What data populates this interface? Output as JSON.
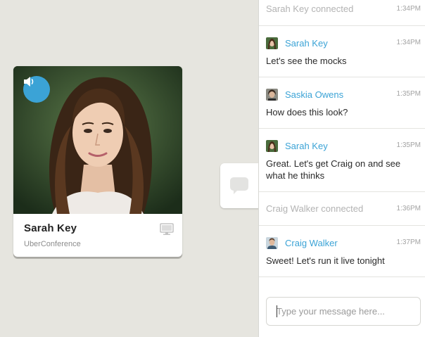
{
  "participant": {
    "name": "Sarah Key",
    "subtitle": "UberConference"
  },
  "icons": {
    "speaker": "speaker-icon",
    "screen": "screen-share-icon",
    "chat": "chat-bubble-icon"
  },
  "colors": {
    "accent": "#3ba3d6",
    "background": "#e6e5df"
  },
  "chat": {
    "events": [
      {
        "type": "system",
        "text": "Sarah Key connected",
        "time": "1:34PM"
      },
      {
        "type": "message",
        "sender": "Sarah Key",
        "time": "1:34PM",
        "text": "Let's see the mocks"
      },
      {
        "type": "message",
        "sender": "Saskia Owens",
        "time": "1:35PM",
        "text": "How does this look?"
      },
      {
        "type": "message",
        "sender": "Sarah Key",
        "time": "1:35PM",
        "text": "Great. Let's get Craig on and see what he thinks"
      },
      {
        "type": "system",
        "text": "Craig Walker connected",
        "time": "1:36PM"
      },
      {
        "type": "message",
        "sender": "Craig Walker",
        "time": "1:37PM",
        "text": "Sweet! Let's run it live tonight"
      }
    ],
    "input_placeholder": "Type your message here..."
  }
}
